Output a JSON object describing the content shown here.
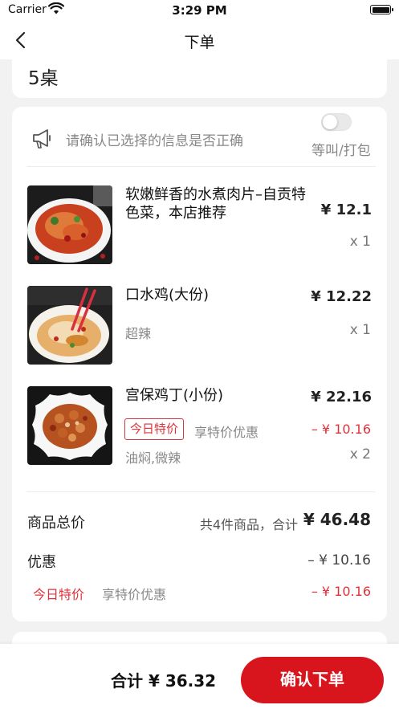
{
  "status_bar": {
    "carrier": "Carrier",
    "time": "3:29 PM"
  },
  "nav": {
    "title": "下单",
    "back_icon": "chevron-left-icon"
  },
  "table": {
    "label": "5桌"
  },
  "notice": {
    "icon": "megaphone-icon",
    "text": "请确认已选择的信息是否正确",
    "toggle_label": "等叫/打包",
    "toggle_on": false
  },
  "items": [
    {
      "name": "软嫩鲜香的水煮肉片–自贡特色菜，本店推荐",
      "price": "¥ 12.1",
      "qty": "x 1"
    },
    {
      "name": "口水鸡(大份)",
      "price": "¥ 12.22",
      "spec": "超辣",
      "qty": "x 1"
    },
    {
      "name": "宫保鸡丁(小份)",
      "price": "¥ 22.16",
      "tag": "今日特价",
      "tag_desc": "享特价优惠",
      "discount": "– ¥ 10.16",
      "spec": "油焖,微辣",
      "qty": "x 2"
    }
  ],
  "summary": {
    "total_label": "商品总价",
    "count_text": "共4件商品，合计",
    "total": "¥ 46.48",
    "promo_label": "优惠",
    "promo_amount": "– ¥ 10.16",
    "promo_tag": "今日特价",
    "promo_desc": "享特价优惠",
    "promo_sub": "– ¥ 10.16"
  },
  "bottom": {
    "sum": "合计 ¥ 36.32",
    "confirm": "确认下单"
  },
  "colors": {
    "accent": "#d8141c",
    "discount": "#e0323a"
  }
}
